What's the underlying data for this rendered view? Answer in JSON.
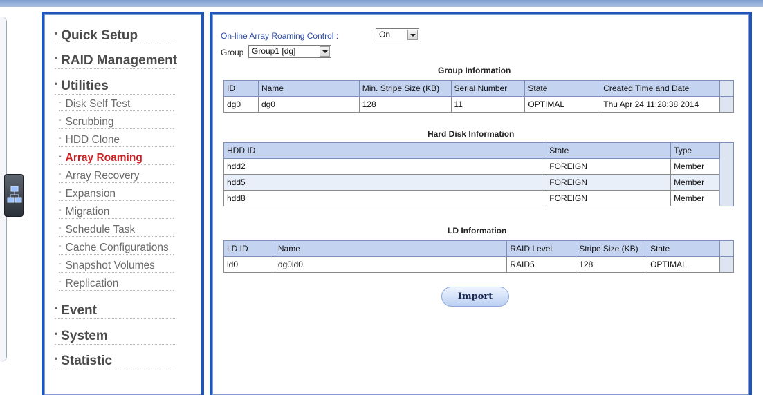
{
  "nav": {
    "quick_setup": "Quick Setup",
    "raid_management": "RAID Management",
    "utilities": "Utilities",
    "sub_items": [
      "Disk Self Test",
      "Scrubbing",
      "HDD Clone",
      "Array Roaming",
      "Array Recovery",
      "Expansion",
      "Migration",
      "Schedule Task",
      "Cache Configurations",
      "Snapshot Volumes",
      "Replication"
    ],
    "event": "Event",
    "system": "System",
    "statistic": "Statistic",
    "active": "Array Roaming",
    "bullet_main": "•",
    "bullet_sub": "-"
  },
  "roaming": {
    "label": "On-line Array Roaming Control :",
    "value": "On"
  },
  "group": {
    "label": "Group",
    "value": "Group1 [dg]"
  },
  "group_info": {
    "title": "Group Information",
    "headers": [
      "ID",
      "Name",
      "Min. Stripe Size (KB)",
      "Serial Number",
      "State",
      "Created Time and Date"
    ],
    "rows": [
      [
        "dg0",
        "dg0",
        "128",
        "11",
        "OPTIMAL",
        "Thu Apr 24 11:28:38 2014"
      ]
    ]
  },
  "hdd_info": {
    "title": "Hard Disk Information",
    "headers": [
      "HDD ID",
      "State",
      "Type"
    ],
    "rows": [
      [
        "hdd2",
        "FOREIGN",
        "Member"
      ],
      [
        "hdd5",
        "FOREIGN",
        "Member"
      ],
      [
        "hdd8",
        "FOREIGN",
        "Member"
      ]
    ]
  },
  "ld_info": {
    "title": "LD Information",
    "headers": [
      "LD ID",
      "Name",
      "RAID Level",
      "Stripe Size (KB)",
      "State"
    ],
    "rows": [
      [
        "ld0",
        "dg0ld0",
        "RAID5",
        "128",
        "OPTIMAL"
      ]
    ]
  },
  "import_label": "Import",
  "colors": {
    "panel_border": "#1f56b8",
    "header_bg": "#c4d3f0",
    "active_nav": "#cc2222",
    "roam_label": "#2a49a6"
  }
}
